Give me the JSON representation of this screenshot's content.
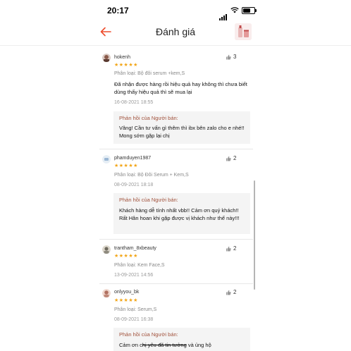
{
  "status": {
    "time": "20:17"
  },
  "header": {
    "title": "Đánh giá"
  },
  "reviews": [
    {
      "username": "hokenh",
      "likes": "3",
      "stars": "★★★★★",
      "variant": "Phân loại: Bộ đôi serum +kem,S",
      "comment": "Đã nhận được hàng rồi hiệu quả hay không thì chưa biết dùng thấy hiệu quả thì sẽ mua lại",
      "date": "16-08-2021 18:55",
      "reply_title": "Phản hồi của Người bán:",
      "reply_text": "Vâng! Cần tư vấn gì thêm thì ibx bên zalo cho e nhé!! Mong sớm gặp lại chị"
    },
    {
      "username": "phamduyen1987",
      "likes": "2",
      "stars": "★★★★★",
      "variant": "Phân loại: Bộ Đôi Serum + Kem,S",
      "date": "08-09-2021 18:18",
      "reply_title": "Phản hồi của Người bán:",
      "reply_text": "Khách hàng dễ tính nhất vbb!! Cảm ơn quý khách!! Rất Hân hoan khi gặp được vị khách như thế này!!!"
    },
    {
      "username": "trantham_8xbeauty",
      "likes": "2",
      "stars": "★★★★★",
      "variant": "Phân loại: Kem Face,S",
      "date": "13-09-2021 14:56"
    },
    {
      "username": "onlyyou_bk",
      "likes": "2",
      "stars": "★★★★★",
      "variant": "Phân loại: Serum,S",
      "date": "08-09-2021 16:38",
      "reply_title": "Phản hồi của Người bán:",
      "reply_text_a": "Cảm ơn c",
      "reply_text_b": "hị yêu đã tin tưởng",
      "reply_text_c": " và ủng hộ"
    }
  ]
}
